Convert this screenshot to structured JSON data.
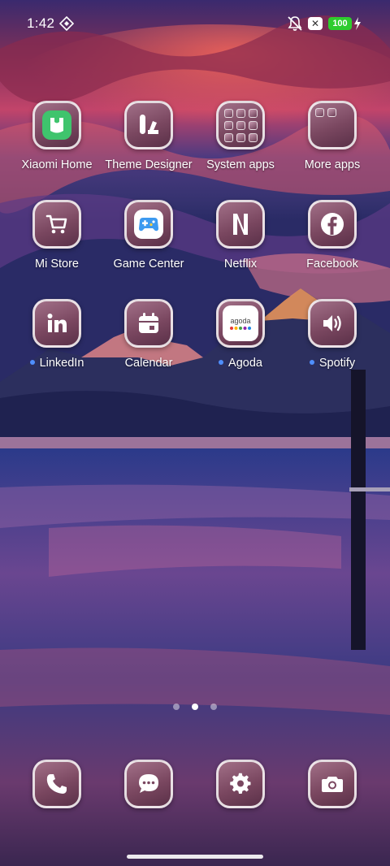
{
  "status_bar": {
    "time": "1:42",
    "battery": "100",
    "notification_badge": "✕"
  },
  "apps": {
    "row1": [
      {
        "label": "Xiaomi Home",
        "icon": "xiaomi-home-icon"
      },
      {
        "label": "Theme Designer",
        "icon": "theme-designer-icon"
      },
      {
        "label": "System apps",
        "icon": "folder-icon"
      },
      {
        "label": "More apps",
        "icon": "folder-icon"
      }
    ],
    "row2": [
      {
        "label": "Mi Store",
        "icon": "cart-icon"
      },
      {
        "label": "Game Center",
        "icon": "gamepad-icon"
      },
      {
        "label": "Netflix",
        "icon": "netflix-icon"
      },
      {
        "label": "Facebook",
        "icon": "facebook-icon"
      }
    ],
    "row3": [
      {
        "label": "LinkedIn",
        "icon": "linkedin-icon",
        "new": true
      },
      {
        "label": "Calendar",
        "icon": "calendar-icon",
        "new": false
      },
      {
        "label": "Agoda",
        "icon": "agoda-icon",
        "new": true,
        "icon_text": "agoda"
      },
      {
        "label": "Spotify",
        "icon": "speaker-icon",
        "new": true
      }
    ]
  },
  "dock": [
    {
      "name": "phone",
      "icon": "phone-icon"
    },
    {
      "name": "messages",
      "icon": "chat-icon"
    },
    {
      "name": "settings",
      "icon": "gear-icon"
    },
    {
      "name": "camera",
      "icon": "camera-icon"
    }
  ],
  "pager": {
    "pages": 3,
    "active": 2
  },
  "colors": {
    "tile": "#7a4760",
    "xiaomi_green": "#3fc46d",
    "badge_blue": "#4f8fff",
    "battery_green": "#2ecc2e"
  }
}
